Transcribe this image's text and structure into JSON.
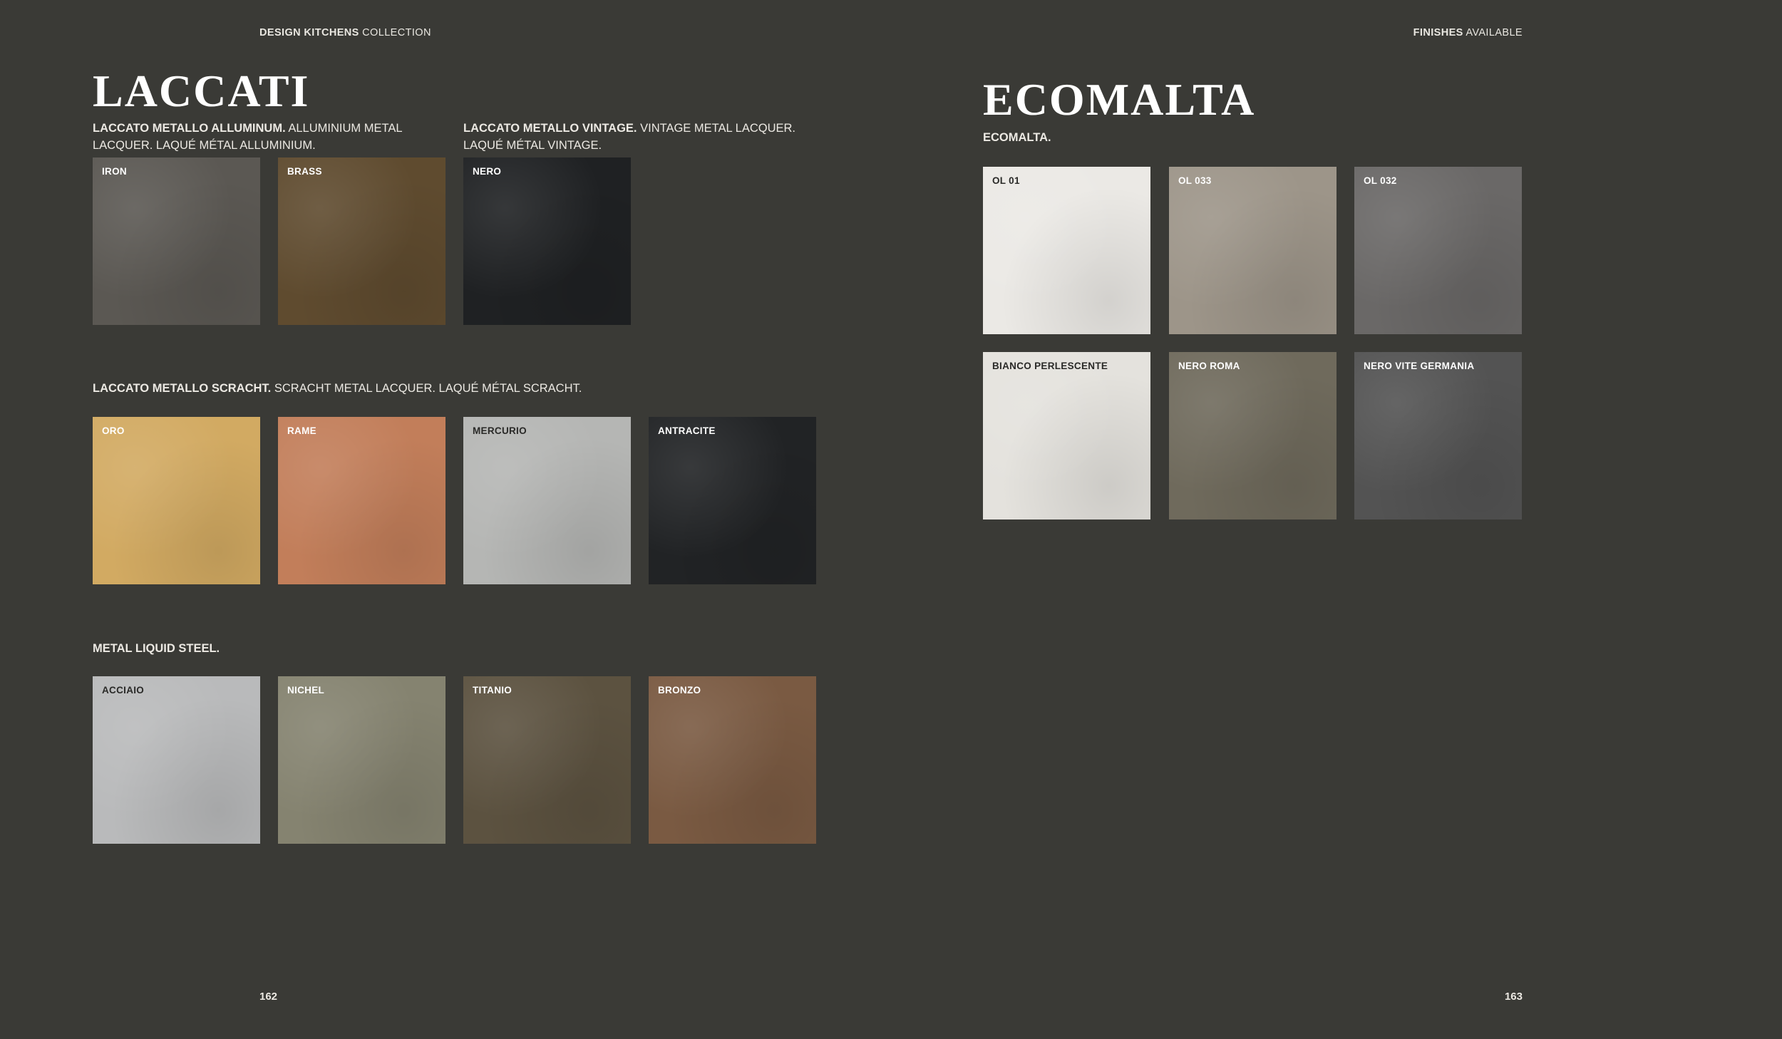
{
  "header": {
    "left_bold": "DESIGN KITCHENS",
    "left_rest": " COLLECTION",
    "right_bold": "FINISHES",
    "right_rest": " AVAILABLE"
  },
  "laccati": {
    "title": "LACCATI",
    "group_alluminum": {
      "bold": "LACCATO METALLO ALLUMINUM.",
      "text": " ALLUMINIUM METAL LACQUER. LAQUÉ MÉTAL ALLUMINIUM.",
      "swatches": [
        {
          "name": "IRON",
          "color": "#5b5853"
        },
        {
          "name": "BRASS",
          "color": "#5f4b2f"
        }
      ]
    },
    "group_vintage": {
      "bold": "LACCATO METALLO VINTAGE.",
      "text": " VINTAGE METAL LACQUER. LAQUÉ MÉTAL VINTAGE.",
      "swatches": [
        {
          "name": "NERO",
          "color": "#1f2123"
        }
      ]
    },
    "group_scratch": {
      "bold": "LACCATO METALLO SCRACHT.",
      "text": " SCRACHT METAL LACQUER. LAQUÉ MÉTAL SCRACHT.",
      "swatches": [
        {
          "name": "ORO",
          "color": "#d2aa62"
        },
        {
          "name": "RAME",
          "color": "#c27e5a"
        },
        {
          "name": "MERCURIO",
          "color": "#b5b6b4"
        },
        {
          "name": "ANTRACITE",
          "color": "#212325"
        }
      ]
    },
    "group_liquid": {
      "bold": "METAL LIQUID STEEL.",
      "text": "",
      "swatches": [
        {
          "name": "ACCIAIO",
          "color": "#b9babb"
        },
        {
          "name": "NICHEL",
          "color": "#858370"
        },
        {
          "name": "TITANIO",
          "color": "#5c5240"
        },
        {
          "name": "BRONZO",
          "color": "#7a5a42"
        }
      ]
    }
  },
  "ecomalta": {
    "title": "ECOMALTA",
    "group": {
      "bold": "ECOMALTA.",
      "text": "",
      "swatches": [
        {
          "name": "OL 01",
          "color": "#ebe9e5"
        },
        {
          "name": "OL 033",
          "color": "#9d9589"
        },
        {
          "name": "OL 032",
          "color": "#6a6867"
        },
        {
          "name": "BIANCO PERLESCENTE",
          "color": "#e4e2dd"
        },
        {
          "name": "NERO ROMA",
          "color": "#6f6a5c"
        },
        {
          "name": "NERO VITE GERMANIA",
          "color": "#535353"
        }
      ]
    }
  },
  "footer": {
    "page_left": "162",
    "page_right": "163"
  }
}
